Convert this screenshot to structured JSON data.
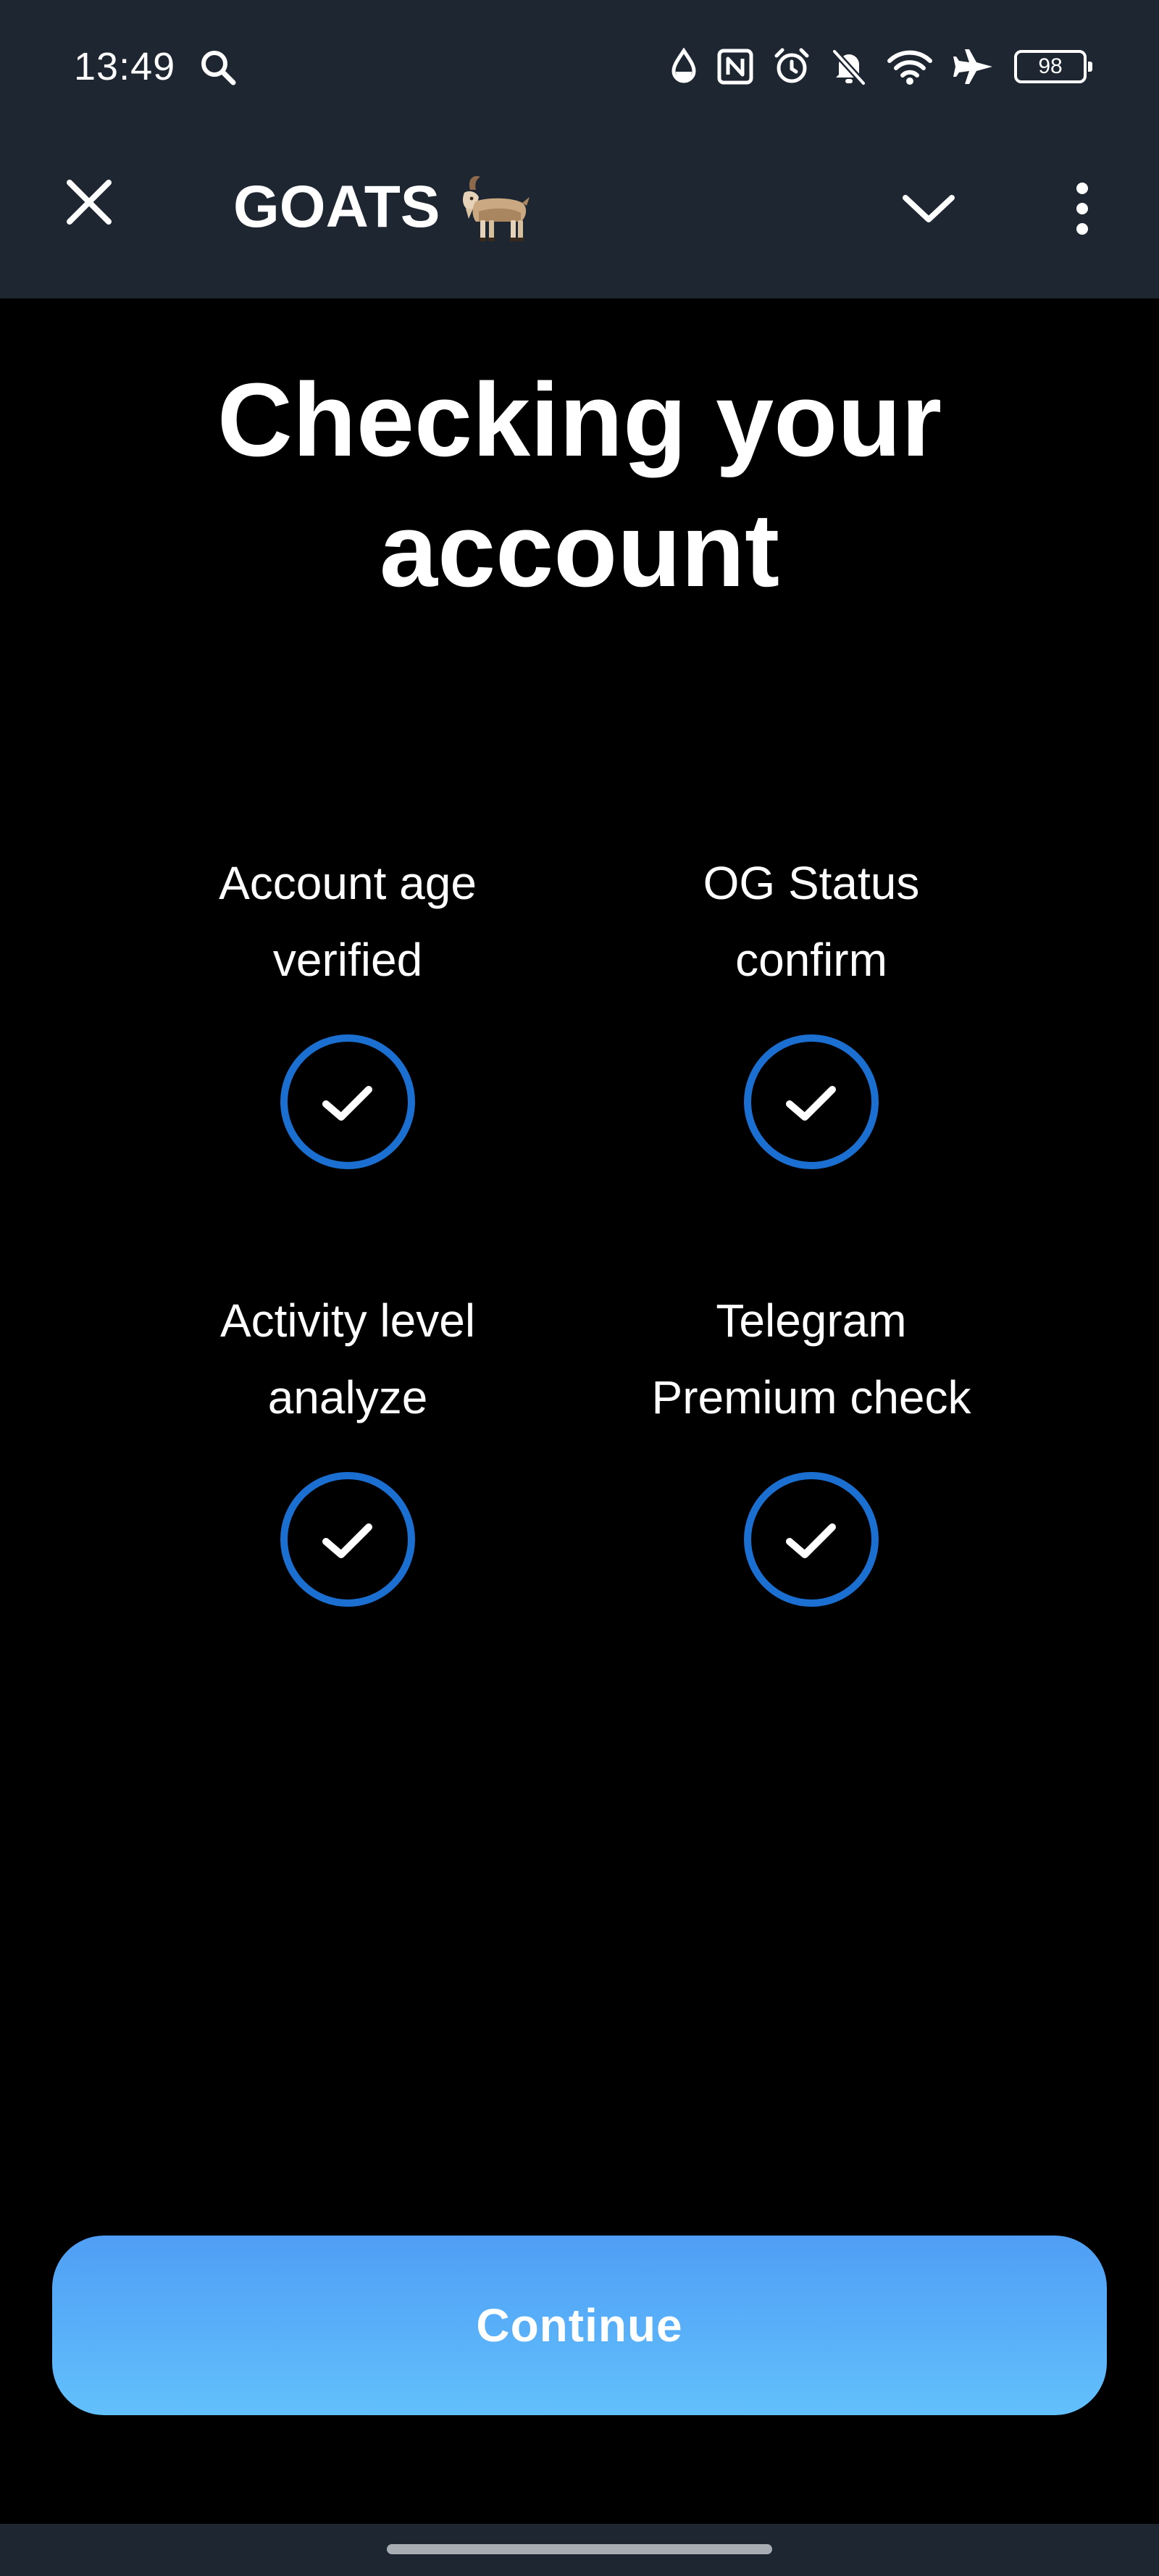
{
  "status_bar": {
    "time": "13:49",
    "icons": [
      "search-icon",
      "water-drop-icon",
      "nfc-icon",
      "alarm-icon",
      "bell-off-icon",
      "wifi-icon",
      "airplane-icon"
    ],
    "battery_level": "98"
  },
  "header": {
    "title": "GOATS",
    "title_icon": "goat-icon",
    "close_icon": "close-icon",
    "chevron_icon": "chevron-down-icon",
    "more_icon": "more-vertical-icon"
  },
  "main": {
    "title_line1": "Checking your",
    "title_line2": "account",
    "checks": [
      {
        "line1": "Account age",
        "line2": "verified",
        "done": true
      },
      {
        "line1": "OG Status",
        "line2": "confirm",
        "done": true
      },
      {
        "line1": "Activity level",
        "line2": "analyze",
        "done": true
      },
      {
        "line1": "Telegram",
        "line2": "Premium check",
        "done": true
      }
    ]
  },
  "footer": {
    "continue_label": "Continue"
  },
  "colors": {
    "background": "#000000",
    "bar": "#1e2631",
    "check_ring": "#1a6fd0",
    "button_top": "#4f9ef5",
    "button_bottom": "#62c0fb"
  }
}
